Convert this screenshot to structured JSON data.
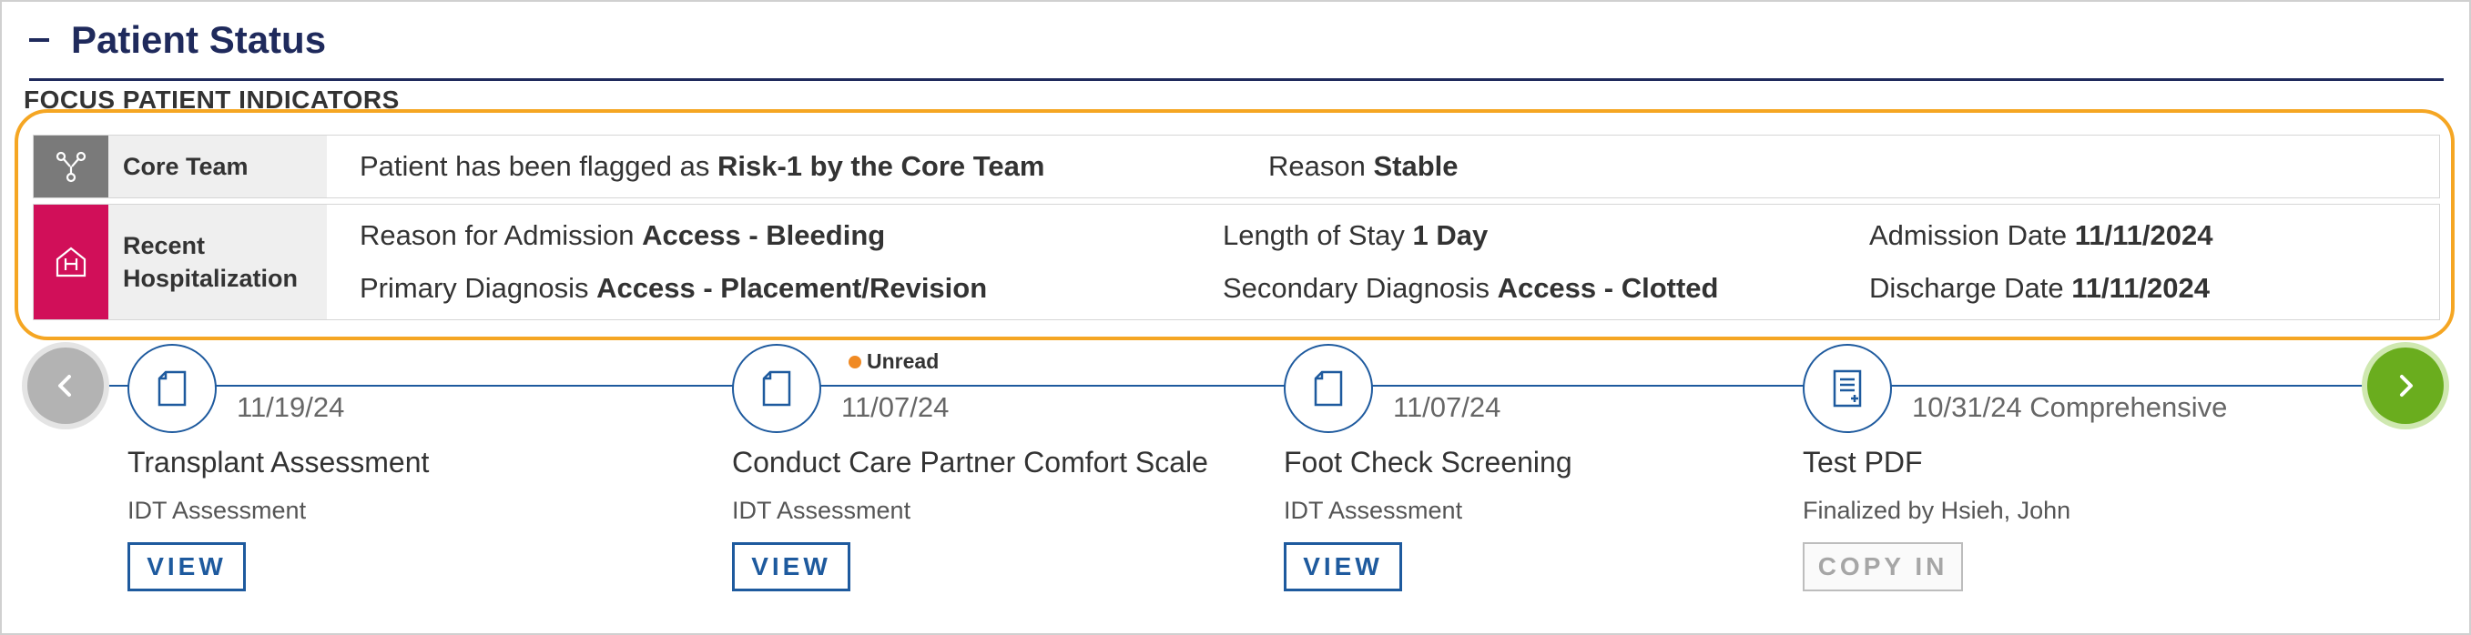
{
  "header": {
    "title": "Patient Status",
    "section_label": "FOCUS PATIENT INDICATORS"
  },
  "indicators": {
    "core_team": {
      "label": "Core Team",
      "icon": "network-icon",
      "flag_prefix": "Patient has been flagged as ",
      "flag_value": "Risk-1 by the Core Team",
      "reason_label": "Reason ",
      "reason_value": "Stable"
    },
    "hospitalization": {
      "label_line1": "Recent",
      "label_line2": "Hospitalization",
      "icon": "hospital-icon",
      "admission_reason_label": "Reason for Admission ",
      "admission_reason_value": "Access - Bleeding",
      "length_of_stay_label": "Length of Stay ",
      "length_of_stay_value": "1 Day",
      "admission_date_label": "Admission Date ",
      "admission_date_value": "11/11/2024",
      "primary_dx_label": "Primary Diagnosis ",
      "primary_dx_value": "Access - Placement/Revision",
      "secondary_dx_label": "Secondary Diagnosis ",
      "secondary_dx_value": "Access - Clotted",
      "discharge_date_label": "Discharge Date ",
      "discharge_date_value": "11/11/2024"
    }
  },
  "timeline": {
    "unread_label": "Unread",
    "items": [
      {
        "date": "11/19/24",
        "title": "Transplant Assessment",
        "subtitle": "IDT Assessment",
        "action": "VIEW",
        "icon": "document-icon"
      },
      {
        "date": "11/07/24",
        "title": "Conduct Care Partner Comfort Scale",
        "subtitle": "IDT Assessment",
        "action": "VIEW",
        "icon": "document-icon"
      },
      {
        "date": "11/07/24",
        "title": "Foot Check Screening",
        "subtitle": "IDT Assessment",
        "action": "VIEW",
        "icon": "document-icon"
      },
      {
        "date": "10/31/24 Comprehensive",
        "title": "Test PDF",
        "subtitle": "Finalized by Hsieh, John",
        "action": "COPY IN",
        "icon": "pdf-document-icon"
      }
    ]
  },
  "colors": {
    "navy": "#1f2a5c",
    "accent_orange": "#f5a623",
    "core_team_gray": "#7a7a7a",
    "hospital_magenta": "#d10f59",
    "timeline_blue": "#1e5a9e",
    "next_green": "#6aad1e",
    "unread_orange": "#f08a24"
  }
}
